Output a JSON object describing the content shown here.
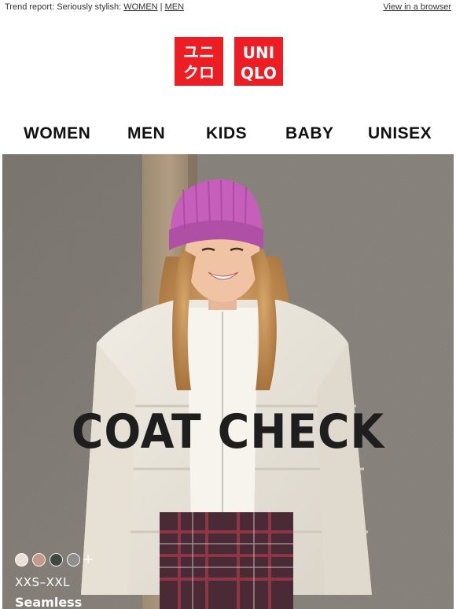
{
  "preheader": {
    "text": "Trend report: Seriously stylish:",
    "women_link": "WOMEN",
    "separator": "|",
    "men_link": "MEN",
    "browser_link": "View in a browser"
  },
  "logo": {
    "brand": "UNIQLO",
    "katakana_top": "ユニ",
    "katakana_bottom": "クロ",
    "latin_top": "UNI",
    "latin_bottom": "QLO",
    "color": "#ed1d24"
  },
  "nav": {
    "items": [
      "WOMEN",
      "MEN",
      "KIDS",
      "BABY",
      "UNISEX"
    ]
  },
  "hero": {
    "headline": "COAT CHECK",
    "swatch_colors": [
      "#e8e1d6",
      "#c39a8a",
      "#3d4a42",
      "#8e8e90"
    ],
    "more_colors": "+",
    "sizes": "XXS–XXL",
    "product_name": "Seamless"
  }
}
